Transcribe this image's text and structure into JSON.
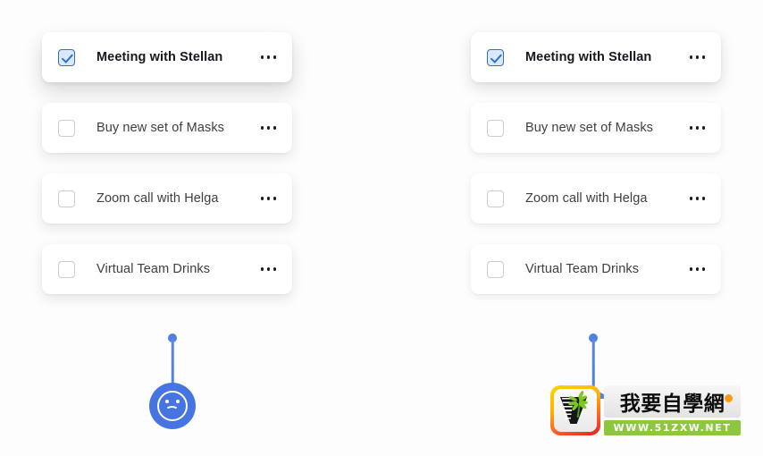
{
  "page": {
    "background_color": "#fdfdfd",
    "title": "Task list card shadow comparison"
  },
  "colors": {
    "accent_blue": "#4674e0",
    "checkbox_checked_border": "#2f6fd0",
    "checkbox_checked_fill": "#dbe8fb",
    "checkbox_unchecked_border": "#c9ccd2",
    "card_background": "#ffffff",
    "label_text": "#3c4043",
    "active_label_text": "#16181d",
    "watermark_green": "#8dc63f",
    "watermark_orange": "#ff9a10"
  },
  "columns": [
    {
      "id": "left",
      "tasks": [
        {
          "label": "Meeting with Stellan",
          "checked": true,
          "active": true,
          "more_label": "more-options"
        },
        {
          "label": "Buy new set of Masks",
          "checked": false,
          "active": false,
          "more_label": "more-options"
        },
        {
          "label": "Zoom call with Helga",
          "checked": false,
          "active": false,
          "more_label": "more-options"
        },
        {
          "label": "Virtual Team Drinks",
          "checked": false,
          "active": false,
          "more_label": "more-options"
        }
      ]
    },
    {
      "id": "right",
      "tasks": [
        {
          "label": "Meeting with Stellan",
          "checked": true,
          "active": true,
          "more_label": "more-options"
        },
        {
          "label": "Buy new set of Masks",
          "checked": false,
          "active": false,
          "more_label": "more-options"
        },
        {
          "label": "Zoom call with Helga",
          "checked": false,
          "active": false,
          "more_label": "more-options"
        },
        {
          "label": "Virtual Team Drinks",
          "checked": false,
          "active": false,
          "more_label": "more-options"
        }
      ]
    }
  ],
  "annotations": {
    "left_pin": {
      "icon": "sad-face-icon",
      "badge_color": "#4674e0"
    },
    "right_pin": {
      "icon": "pin-marker-icon",
      "color": "#4f7fe0"
    }
  },
  "watermark": {
    "logo_icon": "plant-in-v-pot-icon",
    "chinese_text": "我要自學網",
    "url_text": "WWW.51ZXW.NET"
  }
}
